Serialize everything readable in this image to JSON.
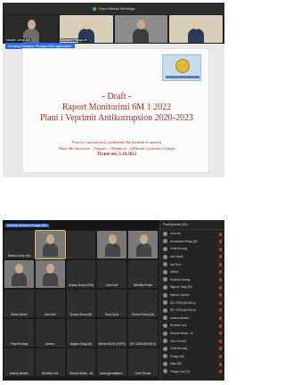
{
  "top": {
    "meeting_title": "Cisco Webex Meetings",
    "sharing_label": "Viewing Besiana Pinaga-Mi's application",
    "participants": [
      {
        "name": "Marika Cerep (M)",
        "style": "dark"
      },
      {
        "name": "Besiana Pinaga-Mi",
        "style": "beige"
      },
      {
        "name": "",
        "style": "room"
      },
      {
        "name": "",
        "style": "beige"
      }
    ],
    "slide": {
      "title_lines": [
        "- Draft -",
        "Raport Monitorimi 6M 1 2022",
        "Plani i Veprimit Antikorrupsion 2020-2023"
      ],
      "sub_lines": [
        "Procesi i monitorimit, analizimit dhe hartimit të raportit",
        "Masa dhe aktivitete – Tregues – Objektivë – Qëllimet e politikës (Qasje)"
      ],
      "place_date": "Tiranë më, 3.10.2022"
    }
  },
  "bottom": {
    "sharing_label": "Sharing Besiana Pinaga-Mi's",
    "gallery": [
      {
        "name": "Marika Cerep (M)",
        "cam": false
      },
      {
        "name": "",
        "cam": true
      },
      {
        "name": "",
        "cam": false
      },
      {
        "name": "",
        "cam": true
      },
      {
        "name": "",
        "cam": true
      },
      {
        "name": "",
        "cam": true
      },
      {
        "name": "",
        "cam": true
      },
      {
        "name": "Aldona Deda (CEN)",
        "cam": false
      },
      {
        "name": "Arta Kolli",
        "cam": false
      },
      {
        "name": "Aferdita Peuka",
        "cam": false
      },
      {
        "name": "Erlina Gerxhi",
        "cam": false
      },
      {
        "name": "Arta Kolli",
        "cam": false
      },
      {
        "name": "Donna Gema (M)",
        "cam": false
      },
      {
        "name": "Ema Gjoni",
        "cam": false
      },
      {
        "name": "Ermira Peuka (M)",
        "cam": false
      },
      {
        "name": "Frida Rrushaj",
        "cam": false
      },
      {
        "name": "juliana",
        "cam": false
      },
      {
        "name": "Migena Tangi-(M)",
        "cam": false
      },
      {
        "name": "Mirela DESH (CEPR)",
        "cam": false
      },
      {
        "name": "DE CORA (BOKA A)",
        "cam": false
      },
      {
        "name": "ardena alimani",
        "cam": false
      },
      {
        "name": "Rezarta Leni",
        "cam": false
      },
      {
        "name": "Ricarda Brass - Mi",
        "cam": false
      },
      {
        "name": "ivana gjemaliaber...",
        "cam": false
      },
      {
        "name": "Tomi Thoma",
        "cam": false
      }
    ],
    "panel": {
      "title": "Participants (32)",
      "rows": [
        "rroni uet",
        "Donarbdea Reçaj (M)",
        "Frida Rrushaj",
        "Indi Lleshi",
        "Indi Roci",
        "juliana",
        "Klodiola Hoxhaj",
        "Migena Tangi-(M)",
        "Marika Ceprani",
        "DE CORA (BOKA A)",
        "DE CORA (BOKA A)",
        "ardena alimani",
        "Rezarta Leni",
        "Ricarda Brass - M",
        "Tomi Thoma",
        "Frida Rrushaj",
        "Pinaga (M)",
        "Maja (M)",
        "Pinaga Luci (H)"
      ]
    }
  }
}
